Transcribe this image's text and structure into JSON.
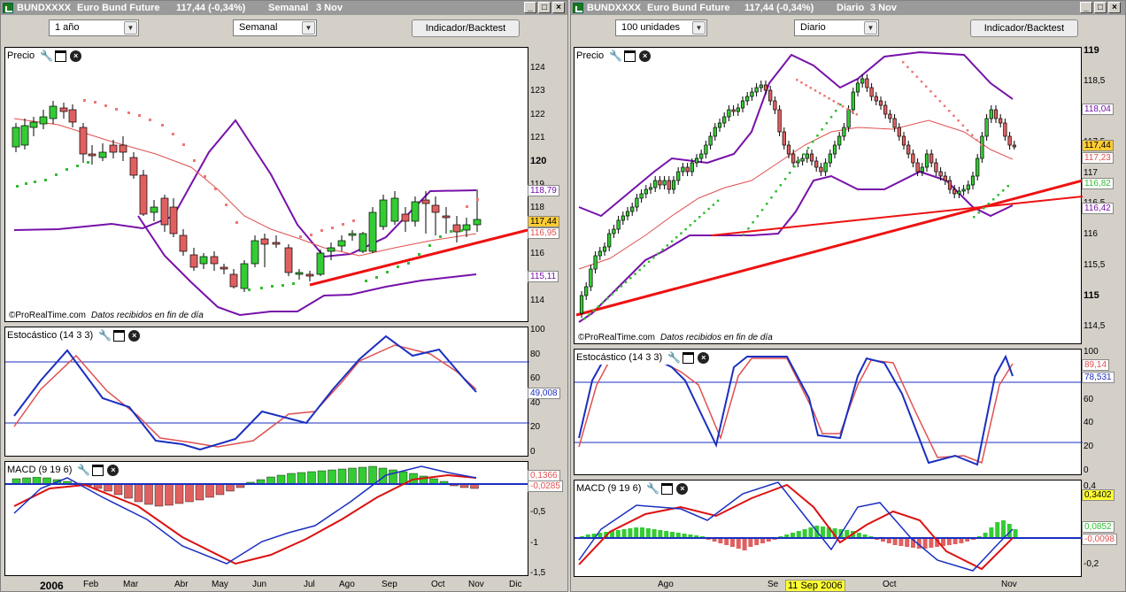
{
  "left": {
    "title": {
      "symbol": "BUNDXXXX",
      "name": "Euro Bund Future",
      "price": "117,44 (-0,34%)",
      "period": "Semanal",
      "date": "3 Nov"
    },
    "controls": {
      "range": "1 año",
      "interval": "Semanal",
      "indicator_btn": "Indicador/Backtest"
    },
    "price_panel": {
      "title": "Precio",
      "footer_brand": "©ProRealTime.com",
      "footer_note": "Datos recibidos en fin de día",
      "axis": [
        "124",
        "123",
        "122",
        "121",
        "120",
        "119",
        "118",
        "117",
        "116",
        "115",
        "114"
      ],
      "tags": {
        "upper": "118,79",
        "last": "117,44",
        "sar": "116,95",
        "lower": "115,11"
      }
    },
    "stoch_panel": {
      "title": "Estocástico (14 3 3)",
      "axis": [
        "100",
        "80",
        "60",
        "40",
        "20",
        "0"
      ],
      "tag": "49,008"
    },
    "macd_panel": {
      "title": "MACD (9 19 6)",
      "axis": [
        "-0,5",
        "-1",
        "-1,5"
      ],
      "tags": {
        "a": "0,1366",
        "b": "-0,0285"
      }
    },
    "xaxis": [
      "2006",
      "Feb",
      "Mar",
      "Abr",
      "May",
      "Jun",
      "Jul",
      "Ago",
      "Sep",
      "Oct",
      "Nov",
      "Dic"
    ]
  },
  "right": {
    "title": {
      "symbol": "BUNDXXXX",
      "name": "Euro Bund Future",
      "price": "117,44 (-0,34%)",
      "period": "Diario",
      "date": "3 Nov"
    },
    "controls": {
      "units": "100 unidades",
      "interval": "Diario",
      "indicator_btn": "Indicador/Backtest"
    },
    "price_panel": {
      "title": "Precio",
      "footer_brand": "©ProRealTime.com",
      "footer_note": "Datos recibidos en fin de día",
      "axis": [
        "119",
        "118,5",
        "118",
        "117,5",
        "117",
        "116,5",
        "116",
        "115,5",
        "115",
        "114,5"
      ],
      "tags": {
        "upper": "118,04",
        "last": "117,44",
        "mid": "117,23",
        "sar": "116,82",
        "lower": "116,42"
      }
    },
    "stoch_panel": {
      "title": "Estocástico (14 3 3)",
      "axis": [
        "100",
        "80",
        "60",
        "40",
        "20",
        "0"
      ],
      "tags": {
        "a": "89,14",
        "b": "78,531"
      }
    },
    "macd_panel": {
      "title": "MACD (9 19 6)",
      "axis": [
        "0,4",
        "0,2",
        "-0,2"
      ],
      "tags": {
        "a": "0,3402",
        "b": "0,0852",
        "c": "-0,0098"
      }
    },
    "xaxis": [
      "Ago",
      "Se",
      "Oct",
      "Nov"
    ],
    "cursor_date": "11 Sep 2006"
  },
  "colors": {
    "bull": "#33cc33",
    "bear": "#e06060",
    "band": "#7711aa",
    "stoch": "#1a2fc0",
    "signal": "#e05050",
    "trend": "#ee1111",
    "sar_up": "#33bb33",
    "sar_dn": "#ee7777"
  }
}
